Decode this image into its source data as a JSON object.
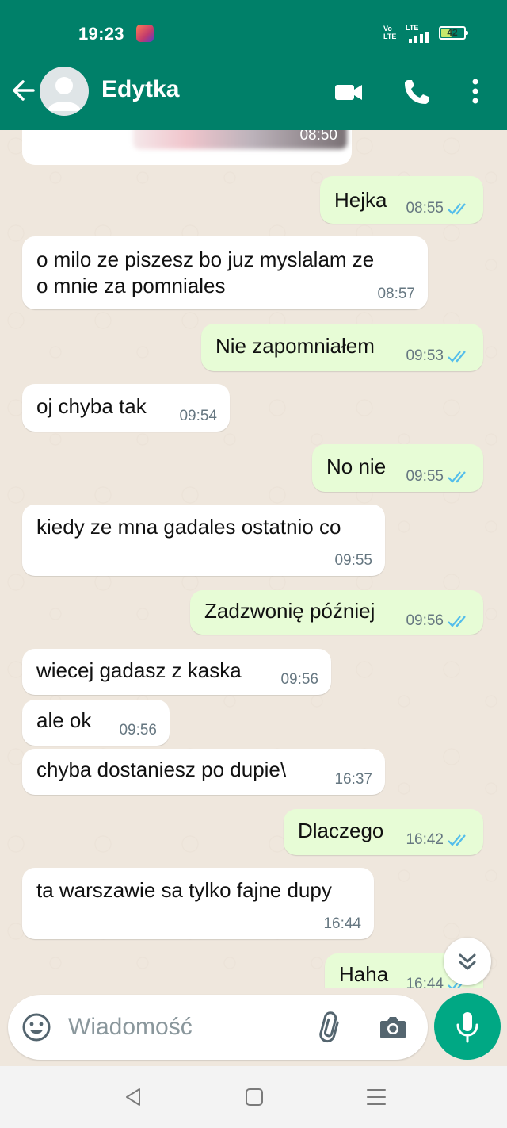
{
  "status_bar": {
    "time": "19:23",
    "volte_top": "Vo",
    "volte_bottom": "LTE",
    "network": "LTE",
    "battery": "42"
  },
  "header": {
    "contact_name": "Edytka"
  },
  "media_message": {
    "time": "08:50"
  },
  "messages": [
    {
      "dir": "out",
      "text": "Hejka",
      "time": "08:55"
    },
    {
      "dir": "in",
      "text": "o milo ze piszesz bo juz myslalam ze\no mnie za pomniales",
      "time": "08:57"
    },
    {
      "dir": "out",
      "text": "Nie zapomniałem",
      "time": "09:53"
    },
    {
      "dir": "in",
      "text": "oj chyba tak",
      "time": "09:54"
    },
    {
      "dir": "out",
      "text": "No nie",
      "time": "09:55"
    },
    {
      "dir": "in",
      "text": "kiedy ze mna gadales ostatnio co",
      "time": "09:55"
    },
    {
      "dir": "out",
      "text": "Zadzwonię później",
      "time": "09:56"
    },
    {
      "dir": "in",
      "text": "wiecej gadasz z kaska",
      "time": "09:56"
    },
    {
      "dir": "in",
      "text": "ale ok",
      "time": "09:56"
    },
    {
      "dir": "in",
      "text": "chyba dostaniesz po dupie\\",
      "time": "16:37"
    },
    {
      "dir": "out",
      "text": "Dlaczego",
      "time": "16:42"
    },
    {
      "dir": "in",
      "text": "ta warszawie sa tylko fajne dupy",
      "time": "16:44"
    },
    {
      "dir": "out",
      "text": "Haha",
      "time": "16:44"
    }
  ],
  "composer": {
    "placeholder": "Wiadomość"
  },
  "colors": {
    "header": "#008069",
    "outgoing": "#e7fcd6",
    "incoming": "#ffffff",
    "read_ticks": "#53bdeb",
    "mic": "#00a884"
  },
  "icons": [
    "back-arrow-icon",
    "video-call-icon",
    "phone-icon",
    "more-icon",
    "double-tick-icon",
    "emoji-icon",
    "paperclip-icon",
    "camera-icon",
    "mic-icon",
    "chevron-down-icon"
  ]
}
